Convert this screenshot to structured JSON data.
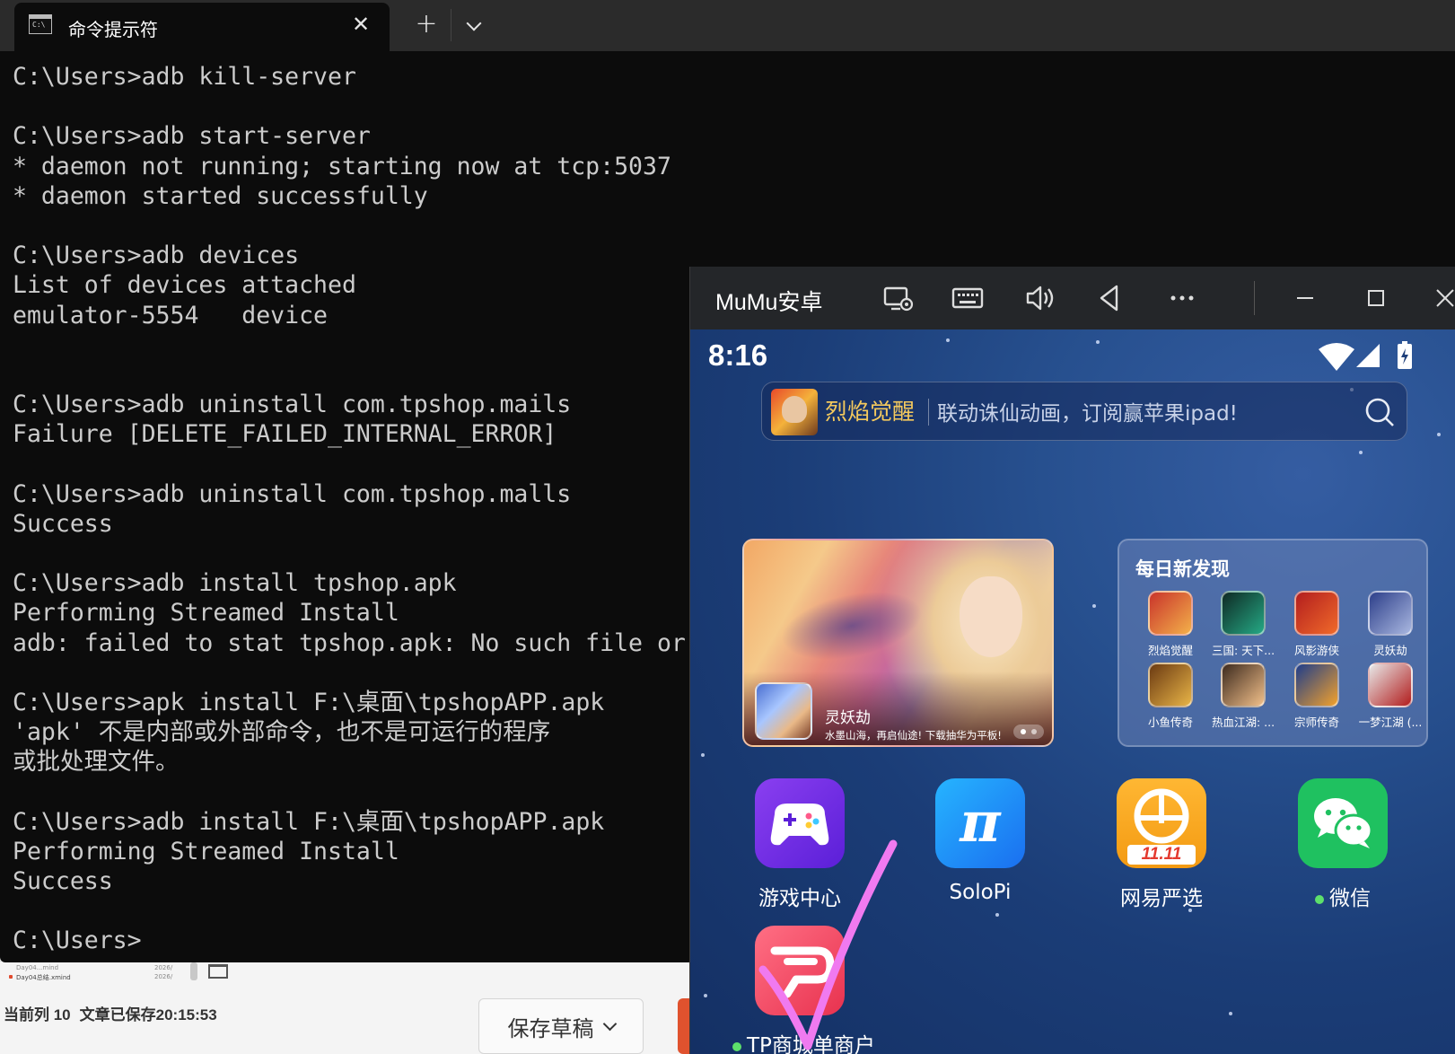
{
  "editor": {
    "file_rows": [
      {
        "name": "Day04...mind",
        "date": "2026/"
      },
      {
        "name": "Day04总结.xmind",
        "date": "2026/"
      }
    ],
    "status_line": "当前列 10",
    "saved_text": "文章已保存20:15:53",
    "save_draft_label": "保存草稿"
  },
  "terminal": {
    "tab_title": "命令提示符",
    "tab_icon_text": "C:\\",
    "close_glyph": "✕",
    "new_tab_glyph": "+",
    "lines": [
      "C:\\Users>adb kill-server",
      "",
      "C:\\Users>adb start-server",
      "* daemon not running; starting now at tcp:5037",
      "* daemon started successfully",
      "",
      "C:\\Users>adb devices",
      "List of devices attached",
      "emulator-5554   device",
      "",
      "",
      "C:\\Users>adb uninstall com.tpshop.mails",
      "Failure [DELETE_FAILED_INTERNAL_ERROR]",
      "",
      "C:\\Users>adb uninstall com.tpshop.malls",
      "Success",
      "",
      "C:\\Users>adb install tpshop.apk",
      "Performing Streamed Install",
      "adb: failed to stat tpshop.apk: No such file or",
      "",
      "C:\\Users>apk install F:\\桌面\\tpshopAPP.apk",
      "'apk' 不是内部或外部命令，也不是可运行的程序",
      "或批处理文件。",
      "",
      "C:\\Users>adb install F:\\桌面\\tpshopAPP.apk",
      "Performing Streamed Install",
      "Success",
      "",
      "C:\\Users>"
    ]
  },
  "mumu": {
    "title": "MuMu安卓",
    "toolbar_icons": [
      "screen-settings-icon",
      "keyboard-icon",
      "volume-icon",
      "back-icon",
      "more-icon",
      "minimize-icon",
      "maximize-icon",
      "close-icon"
    ],
    "android": {
      "time": "8:16",
      "search": {
        "brand": "烈焰觉醒",
        "promo": "联动诛仙动画，订阅赢苹果ipad!"
      },
      "banner": {
        "game": "灵妖劫",
        "desc": "水墨山海，再启仙途! 下载抽华为平板!"
      },
      "daily": {
        "title": "每日新发现",
        "apps": [
          {
            "label": "烈焰觉醒",
            "c1": "#c9342b",
            "c2": "#f3b04a"
          },
          {
            "label": "三国: 天下...",
            "c1": "#0f2a24",
            "c2": "#25a985"
          },
          {
            "label": "风影游侠",
            "c1": "#b31e1e",
            "c2": "#f06a2a"
          },
          {
            "label": "灵妖劫",
            "c1": "#2d3f8a",
            "c2": "#a9b7e0"
          },
          {
            "label": "小鱼传奇",
            "c1": "#6b3a12",
            "c2": "#e8b447"
          },
          {
            "label": "热血江湖: ...",
            "c1": "#3d2a1e",
            "c2": "#f2c08a"
          },
          {
            "label": "宗师传奇",
            "c1": "#1e3d8a",
            "c2": "#f2a12c"
          },
          {
            "label": "一梦江湖 (...",
            "c1": "#e7e7e7",
            "c2": "#b21d1d"
          }
        ]
      },
      "home_apps": [
        {
          "label": "游戏中心",
          "dot": false
        },
        {
          "label": "SoloPi",
          "dot": false
        },
        {
          "label": "网易严选",
          "dot": false
        },
        {
          "label": "微信",
          "dot": true
        },
        {
          "label": "TP商城单商户",
          "dot": true
        }
      ],
      "netease_badge": "11.11"
    }
  },
  "colors": {
    "terminal_bg": "#0c0c0c",
    "terminal_text": "#cccccc",
    "checkmark": "#f07af0",
    "wechat_green": "#1fc160",
    "solopi_blue": "#1a8ef5",
    "netease_orange": "#f5a623",
    "tp_pink": "#f0455e"
  }
}
